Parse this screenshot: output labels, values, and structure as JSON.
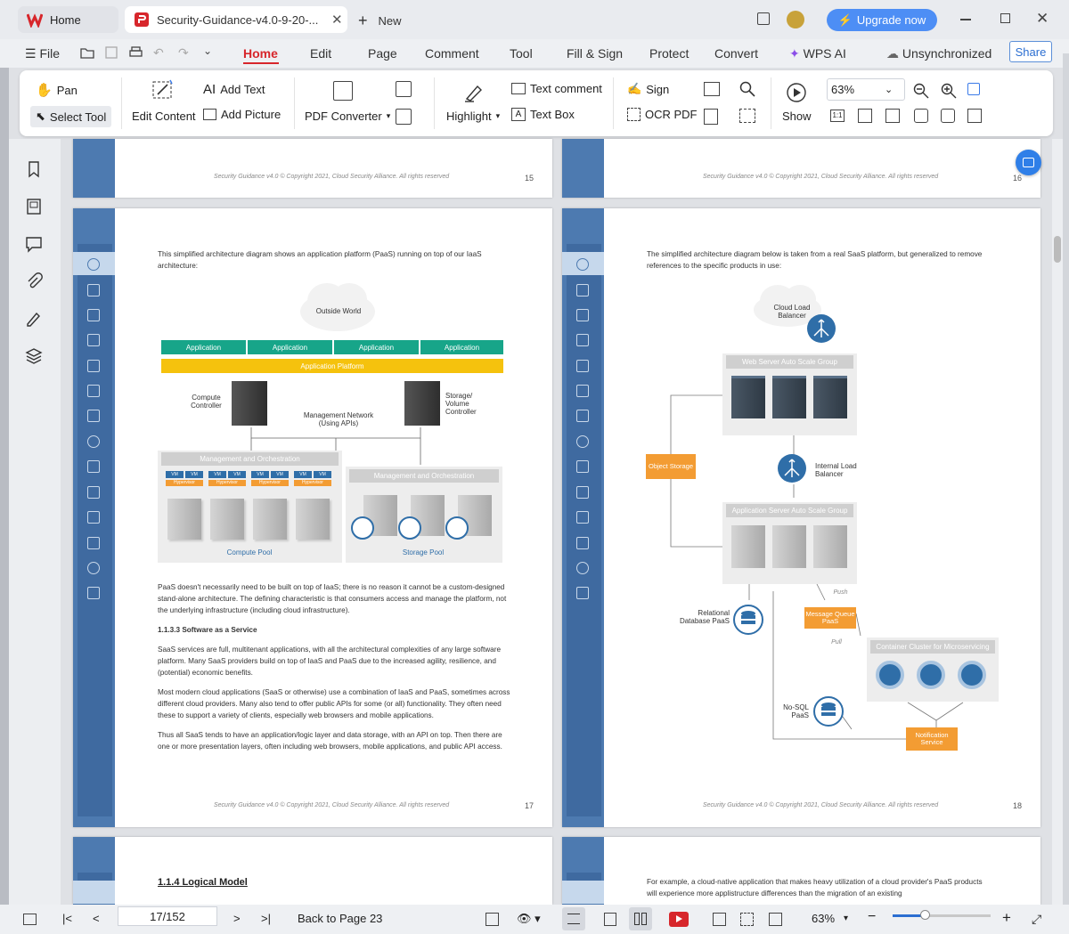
{
  "titlebar": {
    "home_tab": "Home",
    "doc_tab": "Security-Guidance-v4.0-9-20-...",
    "new_tab": "New",
    "upgrade": "Upgrade now"
  },
  "menubar": {
    "file": "File",
    "items": [
      "Home",
      "Edit",
      "Page",
      "Comment",
      "Tool",
      "Fill & Sign",
      "Protect",
      "Convert"
    ],
    "wps_ai": "WPS AI",
    "sync": "Unsynchronized",
    "share": "Share"
  },
  "toolbar": {
    "pan": "Pan",
    "select_tool": "Select Tool",
    "edit_content": "Edit Content",
    "add_text": "Add Text",
    "add_picture": "Add Picture",
    "pdf_converter": "PDF Converter",
    "highlight": "Highlight",
    "text_comment": "Text comment",
    "text_box": "Text Box",
    "sign": "Sign",
    "ocr_pdf": "OCR PDF",
    "show": "Show",
    "zoom": "63%"
  },
  "pages": {
    "p15_footer": "Security Guidance v4.0 © Copyright 2021, Cloud Security Alliance. All rights reserved",
    "p15_number": "15",
    "p16_footer": "Security Guidance v4.0 © Copyright 2021, Cloud Security Alliance. All rights reserved",
    "p16_number": "16",
    "p17": {
      "intro": "This simplified architecture diagram shows an application platform (PaaS) running on top of our IaaS architecture:",
      "outside_world": "Outside World",
      "application": "Application",
      "app_platform": "Application Platform",
      "compute_controller": "Compute Controller",
      "storage_controller": "Storage/ Volume Controller",
      "mgmt_network": "Management Network (Using APIs)",
      "mgmt_orch": "Management and Orchestration",
      "vm": "VM",
      "hypervisor": "Hypervisor",
      "compute_pool": "Compute Pool",
      "storage_pool": "Storage Pool",
      "para1": "PaaS doesn't necessarily need to be built on top of IaaS; there is no reason it cannot be a custom-designed stand-alone architecture. The defining characteristic is that consumers access and manage the platform, not the underlying infrastructure (including cloud infrastructure).",
      "heading": "1.1.3.3 Software as a Service",
      "para2": "SaaS services are full, multitenant applications, with all the architectural complexities of any large software platform. Many SaaS providers build on top of IaaS and PaaS due to the increased agility, resilience, and (potential) economic benefits.",
      "para3": "Most modern cloud applications (SaaS or otherwise) use a combination of IaaS and PaaS, sometimes across different cloud providers. Many also tend to offer public APIs for some (or all) functionality. They often need these to support a variety of clients, especially web browsers and mobile applications.",
      "para4": "Thus all SaaS tends to have an application/logic layer and data storage, with an API on top. Then there are one or more presentation layers, often including web browsers, mobile applications, and public API access.",
      "footer": "Security Guidance v4.0 © Copyright 2021, Cloud Security Alliance. All rights reserved",
      "number": "17"
    },
    "p18": {
      "intro": "The simplified architecture diagram below is taken from a real SaaS platform, but generalized to remove references to the specific products in use:",
      "cloud_lb": "Cloud Load Balancer",
      "web_group": "Web Server Auto Scale Group",
      "object_storage": "Object Storage",
      "internal_lb": "Internal Load Balancer",
      "app_group": "Application Server Auto Scale Group",
      "push": "Push",
      "pull": "Pull",
      "relational_db": "Relational Database PaaS",
      "mq": "Message Queue PaaS",
      "container": "Container Cluster for Microservicing",
      "nosql": "No-SQL PaaS",
      "notification": "Notification Service",
      "footer": "Security Guidance v4.0 © Copyright 2021, Cloud Security Alliance. All rights reserved",
      "number": "18"
    },
    "p19": {
      "heading": "1.1.4 Logical Model"
    },
    "p20": {
      "text": "For example, a cloud-native application that makes heavy utilization of a cloud provider's PaaS products will experience more applistructure differences than the migration of an existing"
    }
  },
  "statusbar": {
    "page": "17/152",
    "back": "Back to Page 23",
    "zoom": "63%"
  },
  "colors": {
    "accent": "#d7262b",
    "brand_blue": "#4d7ab0",
    "teal": "#17a589",
    "yellow": "#f5c20d",
    "orange": "#f39c33",
    "node_blue": "#2f6ea8"
  }
}
